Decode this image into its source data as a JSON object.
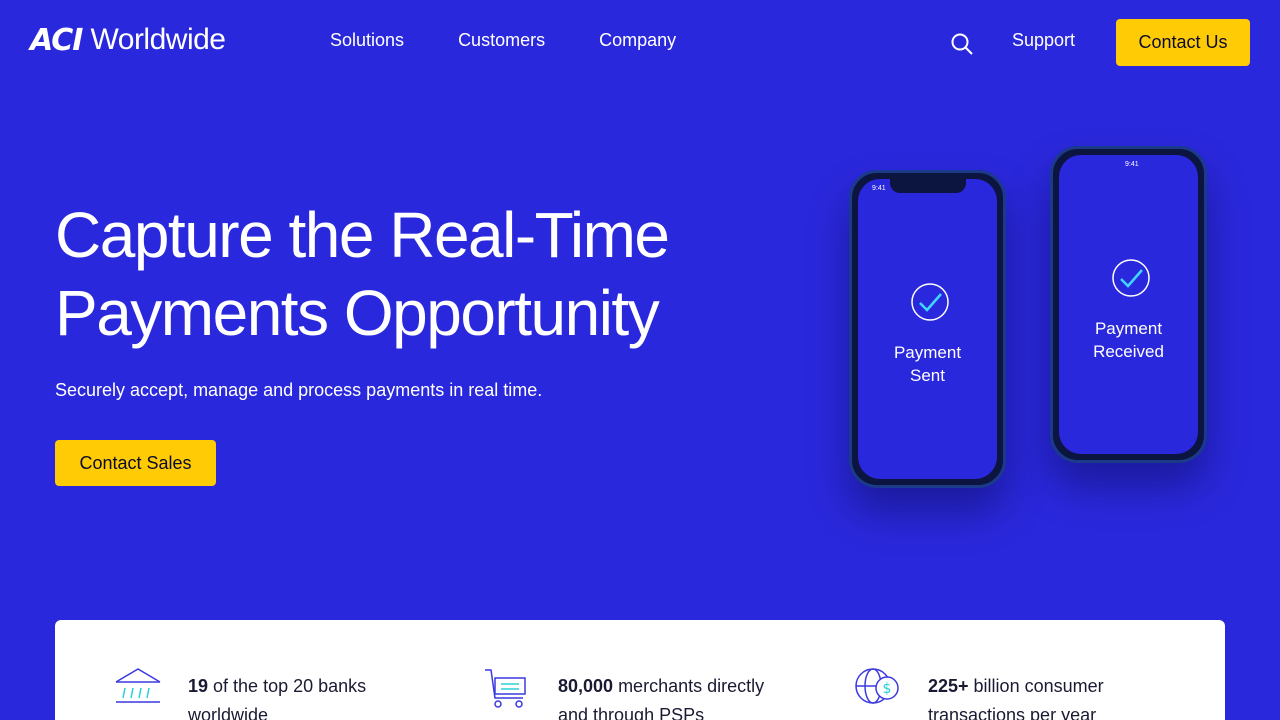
{
  "nav": {
    "logo_mark": "ACI",
    "logo_word": "Worldwide",
    "menu": [
      "Solutions",
      "Customers",
      "Company"
    ],
    "support": "Support",
    "contact_label": "Contact Us"
  },
  "hero": {
    "title_line1": "Capture the Real-Time",
    "title_line2": "Payments Opportunity",
    "subtitle": "Securely accept, manage and process payments in real time.",
    "cta_label": "Contact Sales"
  },
  "phones": {
    "left": {
      "time": "9:41",
      "label_line1": "Payment",
      "label_line2": "Sent"
    },
    "right": {
      "time": "9:41",
      "label_line1": "Payment",
      "label_line2": "Received"
    }
  },
  "stats": [
    {
      "value": "19",
      "text_line1": " of the top 20 banks",
      "text_line2": "worldwide",
      "icon": "bank-icon"
    },
    {
      "value": "80,000",
      "text_line1": " merchants directly",
      "text_line2": "and through PSPs",
      "icon": "shopping-cart-icon"
    },
    {
      "value": "225+",
      "text_line1": " billion consumer",
      "text_line2": "transactions per year",
      "icon": "globe-dollar-icon"
    }
  ],
  "colors": {
    "brand_blue": "#2a28dc",
    "accent_yellow": "#ffcb05"
  }
}
